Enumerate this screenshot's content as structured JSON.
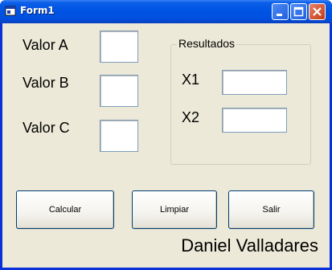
{
  "window": {
    "title": "Form1"
  },
  "labels": {
    "valor_a": "Valor A",
    "valor_b": "Valor B",
    "valor_c": "Valor C"
  },
  "inputs": {
    "valor_a": "",
    "valor_b": "",
    "valor_c": "",
    "x1": "",
    "x2": ""
  },
  "results_group": {
    "title": "Resultados",
    "x1_label": "X1",
    "x2_label": "X2"
  },
  "buttons": {
    "calcular": "Calcular",
    "limpiar": "Limpiar",
    "salir": "Salir"
  },
  "author": "Daniel Valladares",
  "icons": [
    "app-icon",
    "minimize-icon",
    "maximize-icon",
    "close-icon"
  ],
  "colors": {
    "titlebar": "#0054e3",
    "window_bg": "#ece9d8",
    "close_button": "#c33b12"
  }
}
